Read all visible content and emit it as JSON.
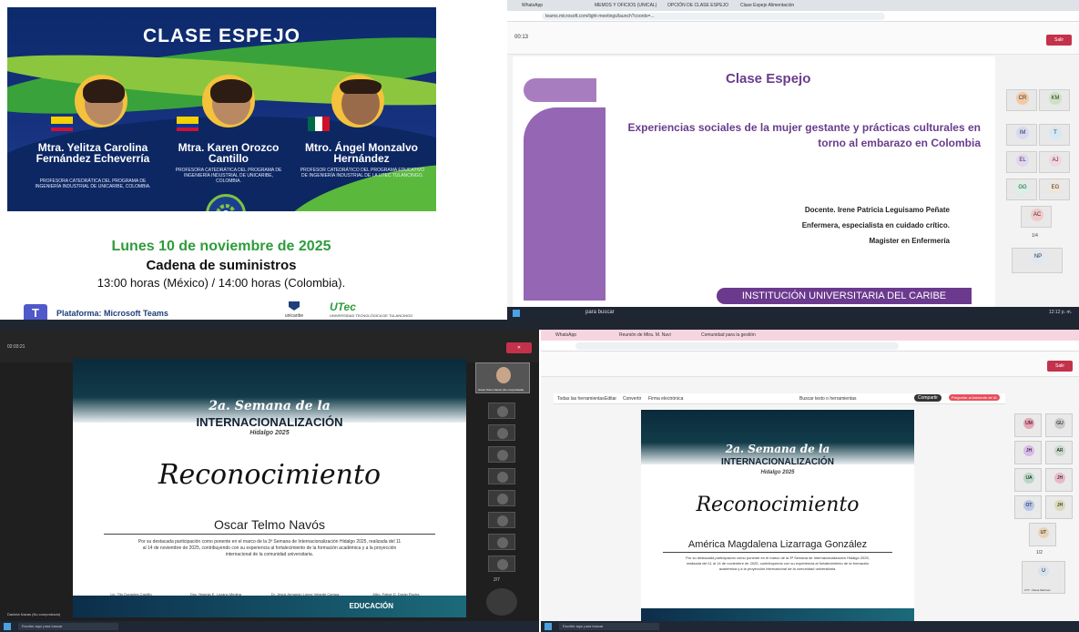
{
  "q1": {
    "title": "CLASE ESPEJO",
    "speakers": [
      {
        "name": "Mtra. Yelitza Carolina Fernández Echeverría",
        "desc": "Profesora catedrática del programa de ingeniería industrial de Unicaribe, Colombia."
      },
      {
        "name": "Mtra. Karen Orozco Cantillo",
        "desc": "Profesora catedrática del programa de ingeniería industrial de Unicaribe, Colombia."
      },
      {
        "name": "Mtro. Ángel Monzalvo Hernández",
        "desc": "Profesor catedrático del programa educativo de ingeniería industrial de la UTEC Tulancingo."
      }
    ],
    "date": "Lunes 10 de noviembre de 2025",
    "topic": "Cadena de suministros",
    "hours": "13:00 horas (México) / 14:00 horas (Colombia).",
    "platform": "Plataforma: Microsoft Teams",
    "logo1": "unicaribe",
    "logo2": "UNIVERSIDAD TECNOLÓGICA DE TULANCINGO"
  },
  "q2": {
    "tabs": [
      "WhatsApp",
      "MEMOS Y OFICIOS (UNICAL)",
      "OPCIÓN DE CLASE ESPEJO",
      "Clase Espejo Alimentación"
    ],
    "url": "teams.microsoft.com/light-meetings/launch?coords=...",
    "timer": "00:13",
    "leave": "Salir",
    "slide_logo": "Clase Espejo",
    "slide_title": "Experiencias sociales de la mujer gestante y prácticas culturales en torno al embarazo en Colombia",
    "teacher": "Docente. Irene Patricia Leguisamo Peñate",
    "role": "Enfermera, especialista en cuidado crítico.",
    "degree": "Magister en Enfermería",
    "institution": "INSTITUCIÓN UNIVERSITARIA DEL CARIBE",
    "participants": [
      "CR",
      "KM",
      "IM",
      "T",
      "EL",
      "AJ",
      "GG",
      "EG",
      "AC",
      "NP"
    ],
    "page": "1/4",
    "taskbar_text": "para buscar",
    "time": "12:12 p. m."
  },
  "q3": {
    "top_time": "02:03:21",
    "event_a": "2a. Semana de la",
    "event_b": "INTERNACIONALIZACIÓN",
    "event_c": "Hidalgo 2025",
    "reco": "Reconocimiento",
    "name": "Oscar  Telmo Navós",
    "body": "Por su destacada participación como ponente en el marco de la 3ª Semana de Internacionalización Hidalgo 2025, realizada del 11 al 14 de noviembre de 2025, contribuyendo con su experiencia al fortalecimiento de la formación académica y a la proyección internacional de la comunidad universitaria.",
    "sigs": [
      "Lic. Tito Dorantes Castillo",
      "Dra. Yesenia E. Lozano Medina",
      "Dr. Jesús Armando López Velarde Campa",
      "Mtro. Felipe D. Durán Rocha"
    ],
    "self_tile": "Oscar Telmo Navós (No comprobado)",
    "page": "2/7",
    "footer": "Daniela Navas (No comprobado)",
    "search": "Escribe aquí para buscar",
    "educacion": "EDUCACIÓN"
  },
  "q4": {
    "tabs": [
      "WhatsApp",
      "Reunión de Mtra. M. Navi",
      "Comunidad para la gestión"
    ],
    "leave": "Salir",
    "viewer_menu": [
      "Todas las herramientas",
      "Editar",
      "Convertir",
      "Firma electrónica"
    ],
    "viewer_search": "Buscar texto o herramientas",
    "share": "Compartir",
    "ask": "Preguntar al Asistente de IA",
    "event_a": "2a. Semana de la",
    "event_b": "INTERNACIONALIZACIÓN",
    "event_c": "Hidalgo 2025",
    "reco": "Reconocimiento",
    "name": "América Magdalena Lizarraga González",
    "body": "Por su destacada participación como ponente en el marco de la 3ª Semana de Internacionalización Hidalgo 2025, realizada del 11 al 14 de noviembre de 2025, contribuyendo con su experiencia al fortalecimiento de la formación académica y a la proyección internacional de la comunidad universitaria.",
    "participants": [
      "UM",
      "GU",
      "JH",
      "AR",
      "UA",
      "JH",
      "OT",
      "JH",
      "UT",
      "U"
    ],
    "page": "1/2",
    "self_tile": "UTT - Diana Martínez",
    "search": "Escribir aquí para buscar"
  },
  "colors": {
    "purple": "#6b3a8e",
    "green": "#2e9c3b",
    "navy": "#0c2a6b",
    "leave": "#c4314b"
  }
}
